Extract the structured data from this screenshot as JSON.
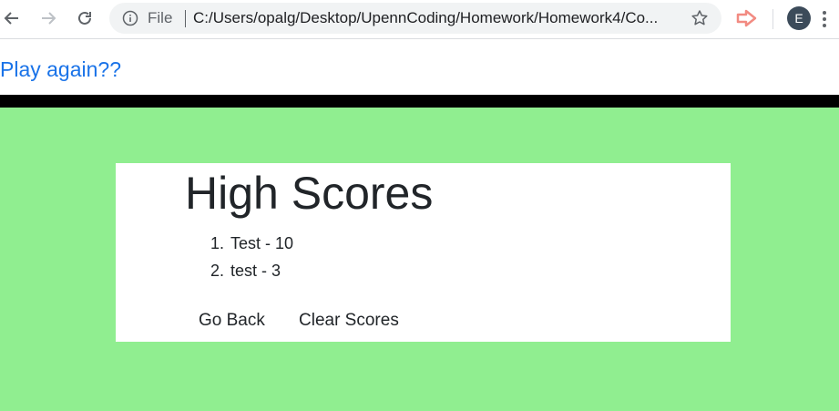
{
  "browser": {
    "file_label": "File",
    "url": "C:/Users/opalg/Desktop/UpennCoding/Homework/Homework4/Co...",
    "profile_initial": "E"
  },
  "page": {
    "play_again_link": "Play again??",
    "heading": "High Scores",
    "scores": [
      "Test - 10",
      "test - 3"
    ],
    "buttons": {
      "go_back": "Go Back",
      "clear_scores": "Clear Scores"
    }
  },
  "colors": {
    "background": "#90ee90",
    "divider_bar": "#000000",
    "link": "#1a73e8",
    "card": "#ffffff"
  }
}
